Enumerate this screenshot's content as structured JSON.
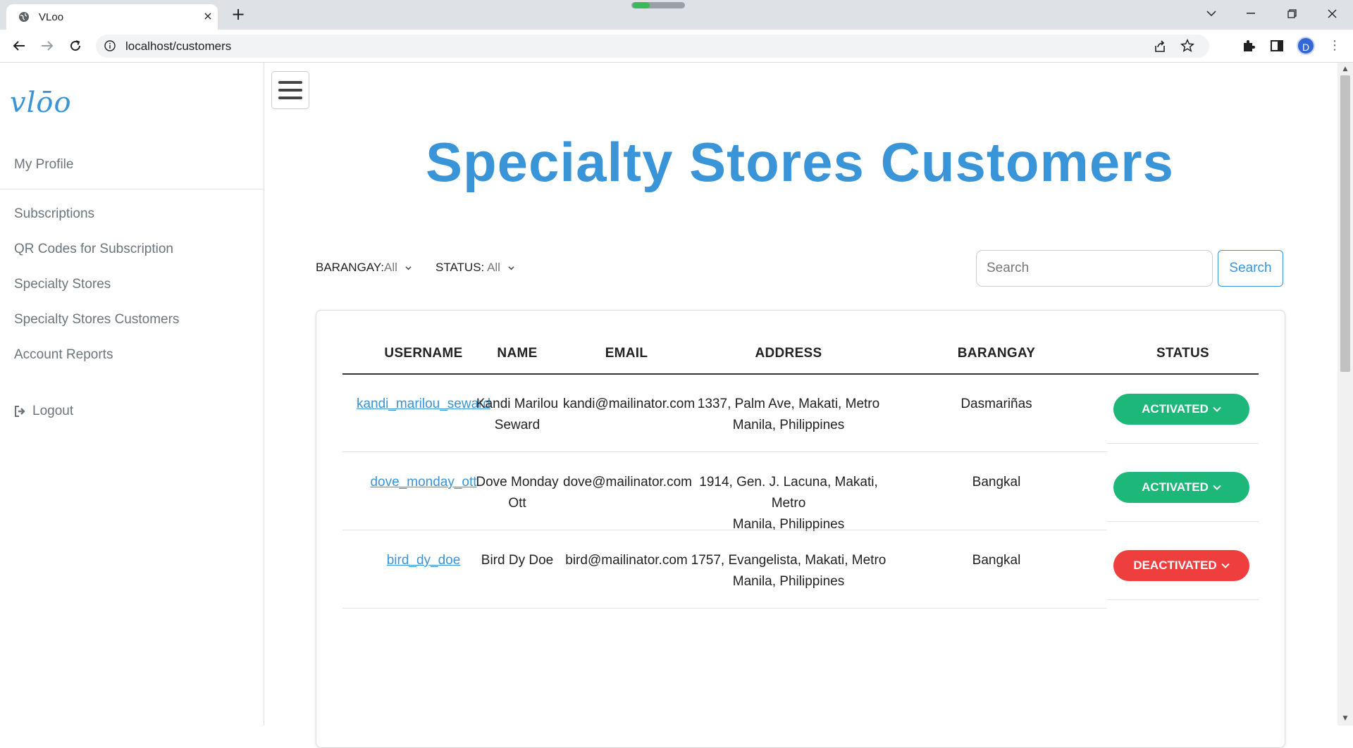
{
  "browser": {
    "tab_title": "VLoo",
    "tab_close": "×",
    "new_tab": "+",
    "url": "localhost/customers",
    "profile_initial": "D",
    "icons": [
      "globe-icon",
      "back-icon",
      "forward-icon",
      "reload-icon",
      "info-icon",
      "share-icon",
      "star-icon",
      "extensions-icon",
      "side-panel-icon",
      "menu-icon",
      "minimize-icon",
      "restore-icon",
      "close-window-icon",
      "tab-search-icon"
    ]
  },
  "sidebar": {
    "logo": "vlōo",
    "profile_link": "My Profile",
    "items": [
      {
        "label": "Subscriptions"
      },
      {
        "label": "QR Codes for Subscription"
      },
      {
        "label": "Specialty Stores"
      },
      {
        "label": "Specialty Stores Customers"
      },
      {
        "label": "Account Reports"
      }
    ],
    "logout": "Logout"
  },
  "main": {
    "title": "Specialty Stores Customers",
    "filters": {
      "barangay_label": "BARANGAY:",
      "barangay_value": "All",
      "status_label": "STATUS:",
      "status_value": "All"
    },
    "search": {
      "placeholder": "Search",
      "button": "Search"
    },
    "table": {
      "headers": [
        "USERNAME",
        "NAME",
        "EMAIL",
        "ADDRESS",
        "BARANGAY",
        "STATUS"
      ],
      "rows": [
        {
          "username": "kandi_marilou_seward",
          "name_1": "Kandi Marilou",
          "name_2": "Seward",
          "email": "kandi@mailinator.com",
          "address_1": "1337, Palm Ave, Makati, Metro",
          "address_2": "Manila, Philippines",
          "barangay": "Dasmariñas",
          "status": "ACTIVATED"
        },
        {
          "username": "dove_monday_ott",
          "name_1": "Dove Monday",
          "name_2": "Ott",
          "email": "dove@mailinator.com",
          "address_1": "1914, Gen. J. Lacuna, Makati, Metro",
          "address_2": "Manila, Philippines",
          "barangay": "Bangkal",
          "status": "ACTIVATED"
        },
        {
          "username": "bird_dy_doe",
          "name_1": "Bird Dy Doe",
          "name_2": "",
          "email": "bird@mailinator.com",
          "address_1": "1757, Evangelista, Makati, Metro",
          "address_2": "Manila, Philippines",
          "barangay": "Bangkal",
          "status": "DEACTIVATED"
        }
      ]
    }
  },
  "colors": {
    "accent": "#3a94d8",
    "activated": "#1db779",
    "deactivated": "#ef3e3e"
  }
}
